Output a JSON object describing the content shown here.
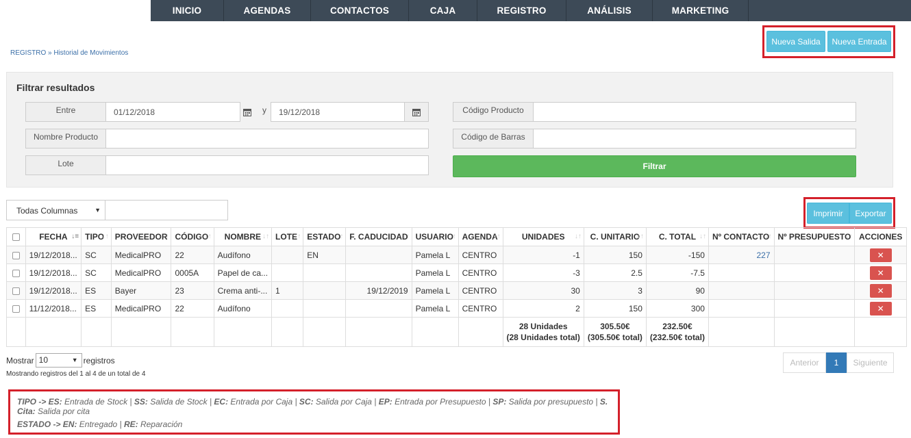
{
  "nav": [
    "INICIO",
    "AGENDAS",
    "CONTACTOS",
    "CAJA",
    "REGISTRO",
    "ANÁLISIS",
    "MARKETING"
  ],
  "breadcrumb": "REGISTRO » Historial de Movimientos",
  "actions": {
    "salida": "Nueva Salida",
    "entrada": "Nueva Entrada"
  },
  "filter": {
    "title": "Filtrar resultados",
    "entre_label": "Entre",
    "date_from": "01/12/2018",
    "y_label": "y",
    "date_to": "19/12/2018",
    "codigo_label": "Código Producto",
    "nombre_label": "Nombre Producto",
    "barras_label": "Código de Barras",
    "lote_label": "Lote",
    "filtrar": "Filtrar"
  },
  "search": {
    "column_select": "Todas Columnas"
  },
  "export": {
    "imprimir": "Imprimir",
    "exportar": "Exportar"
  },
  "table": {
    "headers": [
      "FECHA",
      "TIPO",
      "PROVEEDOR",
      "CÓDIGO",
      "NOMBRE",
      "LOTE",
      "ESTADO",
      "F. CADUCIDAD",
      "USUARIO",
      "AGENDA",
      "UNIDADES",
      "C. UNITARIO",
      "C. TOTAL",
      "Nº CONTACTO",
      "Nº PRESUPUESTO",
      "ACCIONES"
    ],
    "rows": [
      [
        "19/12/2018...",
        "SC",
        "MedicalPRO",
        "22",
        "Audífono",
        "",
        "EN",
        "",
        "Pamela L",
        "CENTRO",
        "-1",
        "150",
        "-150",
        "227",
        ""
      ],
      [
        "19/12/2018...",
        "SC",
        "MedicalPRO",
        "0005A",
        "Papel de ca...",
        "",
        "",
        "",
        "Pamela L",
        "CENTRO",
        "-3",
        "2.5",
        "-7.5",
        "",
        ""
      ],
      [
        "19/12/2018...",
        "ES",
        "Bayer",
        "23",
        "Crema anti-...",
        "1",
        "",
        "19/12/2019",
        "Pamela L",
        "CENTRO",
        "30",
        "3",
        "90",
        "",
        ""
      ],
      [
        "11/12/2018...",
        "ES",
        "MedicalPRO",
        "22",
        "Audífono",
        "",
        "",
        "",
        "Pamela L",
        "CENTRO",
        "2",
        "150",
        "300",
        "",
        ""
      ]
    ],
    "totals": {
      "unidades_1": "28 Unidades",
      "unidades_2": "(28 Unidades total)",
      "unitario_1": "305.50€",
      "unitario_2": "(305.50€ total)",
      "total_1": "232.50€",
      "total_2": "(232.50€ total)"
    },
    "delete_glyph": "✕"
  },
  "length": {
    "mostrar": "Mostrar",
    "value": "10",
    "registros": "registros"
  },
  "info": "Mostrando registros del 1 al 4 de un total de 4",
  "pager": {
    "prev": "Anterior",
    "page": "1",
    "next": "Siguiente"
  },
  "legend": {
    "line1": [
      {
        "b": "TIPO -> ES:",
        "t": " Entrada de Stock | "
      },
      {
        "b": "SS:",
        "t": " Salida de Stock | "
      },
      {
        "b": "EC:",
        "t": " Entrada por Caja | "
      },
      {
        "b": "SC:",
        "t": " Salida por Caja | "
      },
      {
        "b": "EP:",
        "t": " Entrada por Presupuesto | "
      },
      {
        "b": "SP:",
        "t": " Salida por presupuesto | "
      },
      {
        "b": "S. Cita:",
        "t": " Salida por cita"
      }
    ],
    "line2": [
      {
        "b": "ESTADO -> EN:",
        "t": " Entregado | "
      },
      {
        "b": "RE:",
        "t": " Reparación"
      }
    ]
  },
  "colors": {
    "nav_bg": "#3d4a57",
    "info_btn": "#5bc0de",
    "success_btn": "#5cb85c",
    "danger_btn": "#d9534f",
    "highlight_border": "#d4202a",
    "pager_active": "#337ab7"
  }
}
